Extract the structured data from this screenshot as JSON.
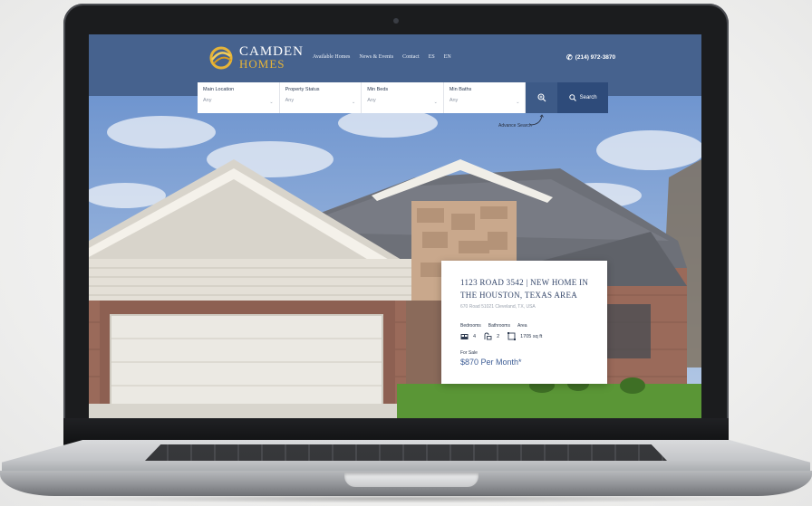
{
  "site": {
    "logo_line1": "CAMDEN",
    "logo_line2": "HOMES",
    "nav": [
      "Available Homes",
      "News & Events",
      "Contact",
      "ES",
      "EN"
    ],
    "phone": "(214) 972-3870"
  },
  "search": {
    "fields": [
      {
        "label": "Main Location",
        "value": "Any"
      },
      {
        "label": "Property Status",
        "value": "Any"
      },
      {
        "label": "Min Beds",
        "value": "Any"
      },
      {
        "label": "Min Baths",
        "value": "Any"
      }
    ],
    "button_label": "Search",
    "advanced_link": "Advance Search"
  },
  "listing": {
    "title": "1123 Road 3542 | New Home in the Houston, Texas Area",
    "address": "670 Road 51021 Cleveland, TX, USA",
    "spec_labels": {
      "bedrooms": "Bedrooms",
      "bathrooms": "Bathrooms",
      "area": "Area"
    },
    "bedrooms": "4",
    "bathrooms": "2",
    "area": "1705 sq ft",
    "status": "For Sale",
    "price": "$870 Per Month*"
  },
  "icons": [
    "phone-icon",
    "magnifier-plus-icon",
    "search-icon",
    "bed-icon",
    "bath-icon",
    "area-icon",
    "chevron-down-icon"
  ],
  "colors": {
    "header": "#46628e",
    "accent_gold": "#e6b438",
    "search_button": "#2e4b7a",
    "price": "#3d5d95"
  }
}
